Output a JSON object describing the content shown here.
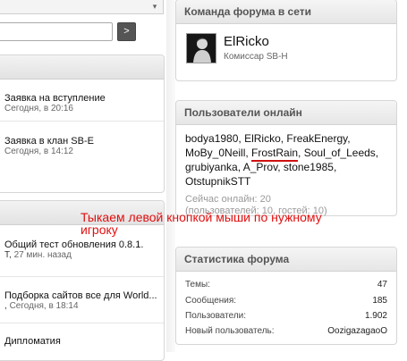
{
  "left": {
    "search_button_label": ">",
    "topbar_arrow": "▾",
    "box1_rows": [
      {
        "title": "Заявка на вступление",
        "meta": "Сегодня, в 20:16"
      },
      {
        "title": "Заявка в клан SB-E",
        "meta": "Сегодня, в 14:12"
      }
    ],
    "box2_rows": [
      {
        "title": "Общий тест обновления 0.8.1.",
        "meta_prefix": "T,",
        "meta": "27 мин. назад"
      },
      {
        "title": "Подборка сайтов все для World...",
        "meta_prefix": ",",
        "meta": "Сегодня, в 18:14"
      },
      {
        "title": "Дипломатия",
        "meta_prefix": "",
        "meta": ""
      }
    ]
  },
  "staff_box": {
    "title": "Команда форума в сети",
    "member_name": "ElRicko",
    "member_role": "Комиссар SB-H",
    "avatar_icon": "avatar-photo-icon"
  },
  "online_box": {
    "title": "Пользователи онлайн",
    "users": [
      "bodya1980",
      "ElRicko",
      "FreakEnergy",
      "MoBy_0Neill",
      "FrostRain",
      "Soul_of_Leeds",
      "grubiyanka",
      "A_Prov",
      "stone1985",
      "OtstupnikSTT"
    ],
    "highlighted_user": "FrostRain",
    "online_now_label": "Сейчас онлайн: 20",
    "online_breakdown": "(пользователей: 10, гостей: 10)"
  },
  "stats_box": {
    "title": "Статистика форума",
    "rows": [
      {
        "label": "Темы:",
        "value": "47"
      },
      {
        "label": "Сообщения:",
        "value": "185"
      },
      {
        "label": "Пользователи:",
        "value": "1.902"
      },
      {
        "label": "Новый пользователь:",
        "value": "OozigazagaoO"
      }
    ]
  },
  "annotation": {
    "text": "Тыкаем левой кнопкой мыши по нужному игроку",
    "color": "#e01010"
  }
}
